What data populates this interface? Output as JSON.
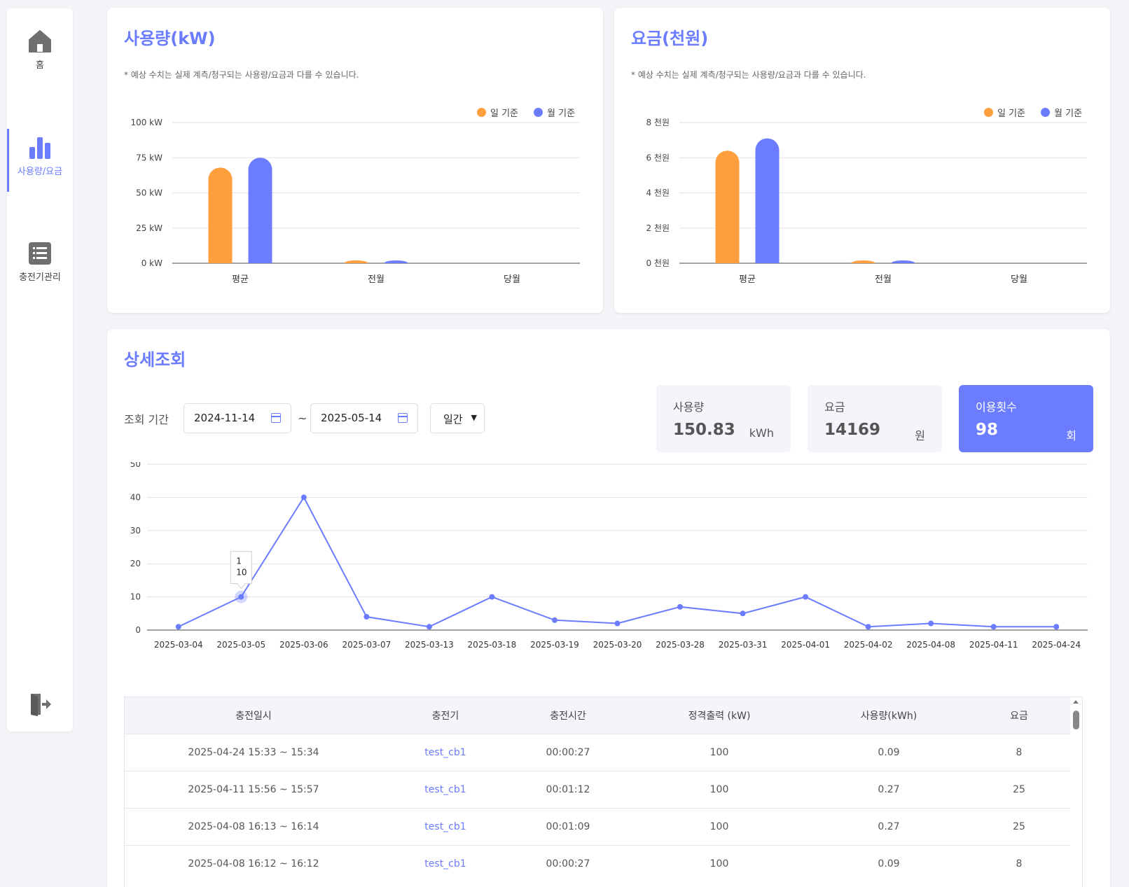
{
  "sidebar": {
    "items": [
      {
        "label": "홈",
        "icon": "home-icon"
      },
      {
        "label": "사용량/요금",
        "icon": "bar-chart-icon",
        "active": true
      },
      {
        "label": "충전기관리",
        "icon": "list-icon"
      }
    ],
    "logout_icon": "logout-icon"
  },
  "usage_card": {
    "title": "사용량(kW)",
    "note": "* 예상 수치는 실제 계측/청구되는 사용량/요금과 다를 수 있습니다.",
    "legend": [
      {
        "label": "일 기준",
        "color": "#ff9e3d"
      },
      {
        "label": "월 기준",
        "color": "#6b7cff"
      }
    ]
  },
  "fee_card": {
    "title": "요금(천원)",
    "note": "* 예상 수치는 실제 계측/청구되는 사용량/요금과 다를 수 있습니다.",
    "legend": [
      {
        "label": "일 기준",
        "color": "#ff9e3d"
      },
      {
        "label": "월 기준",
        "color": "#6b7cff"
      }
    ]
  },
  "detail": {
    "title": "상세조회",
    "filter_label": "조회 기간",
    "start_date": "2024-11-14",
    "end_date": "2025-05-14",
    "tilde": "~",
    "period_select": "일간",
    "stats": [
      {
        "label": "사용량",
        "value": "150.83",
        "unit": "kWh"
      },
      {
        "label": "요금",
        "value": "14169",
        "unit": "원"
      },
      {
        "label": "이용횟수",
        "value": "98",
        "unit": "회"
      }
    ],
    "table": {
      "headers": [
        "충전일시",
        "충전기",
        "충전시간",
        "정격출력 (kW)",
        "사용량(kWh)",
        "요금"
      ],
      "rows": [
        [
          "2025-04-24 15:33 ~ 15:34",
          "test_cb1",
          "00:00:27",
          "100",
          "0.09",
          "8"
        ],
        [
          "2025-04-11 15:56 ~ 15:57",
          "test_cb1",
          "00:01:12",
          "100",
          "0.27",
          "25"
        ],
        [
          "2025-04-08 16:13 ~ 16:14",
          "test_cb1",
          "00:01:09",
          "100",
          "0.27",
          "25"
        ],
        [
          "2025-04-08 16:12 ~ 16:12",
          "test_cb1",
          "00:00:27",
          "100",
          "0.09",
          "8"
        ]
      ]
    }
  },
  "chart_data": [
    {
      "type": "bar",
      "categories": [
        "평균",
        "전월",
        "당월"
      ],
      "series": [
        {
          "name": "일 기준",
          "color": "#ff9e3d",
          "values": [
            68,
            1,
            0
          ]
        },
        {
          "name": "월 기준",
          "color": "#6b7cff",
          "values": [
            75,
            1,
            0
          ]
        }
      ],
      "ylim": [
        0,
        100
      ],
      "yticks": [
        "0 kW",
        "25 kW",
        "50 kW",
        "75 kW",
        "100 kW"
      ]
    },
    {
      "type": "bar",
      "categories": [
        "평균",
        "전월",
        "당월"
      ],
      "series": [
        {
          "name": "일 기준",
          "color": "#ff9e3d",
          "values": [
            6.4,
            0.1,
            0
          ]
        },
        {
          "name": "월 기준",
          "color": "#6b7cff",
          "values": [
            7.1,
            0.1,
            0
          ]
        }
      ],
      "ylim": [
        0,
        8
      ],
      "yticks": [
        "0 천원",
        "2 천원",
        "4 천원",
        "6 천원",
        "8 천원"
      ]
    },
    {
      "type": "line",
      "x": [
        "2025-03-04",
        "2025-03-05",
        "2025-03-06",
        "2025-03-07",
        "2025-03-13",
        "2025-03-18",
        "2025-03-19",
        "2025-03-20",
        "2025-03-28",
        "2025-03-31",
        "2025-04-01",
        "2025-04-02",
        "2025-04-08",
        "2025-04-11",
        "2025-04-24"
      ],
      "values": [
        1,
        10,
        40,
        4,
        1,
        10,
        3,
        2,
        7,
        5,
        10,
        1,
        2,
        1,
        1
      ],
      "color": "#6b7cff",
      "ylim": [
        0,
        50
      ],
      "yticks": [
        "0",
        "10",
        "20",
        "30",
        "40",
        "50"
      ],
      "tooltip": {
        "index": 1,
        "line1": "1",
        "line2": "10"
      }
    }
  ]
}
